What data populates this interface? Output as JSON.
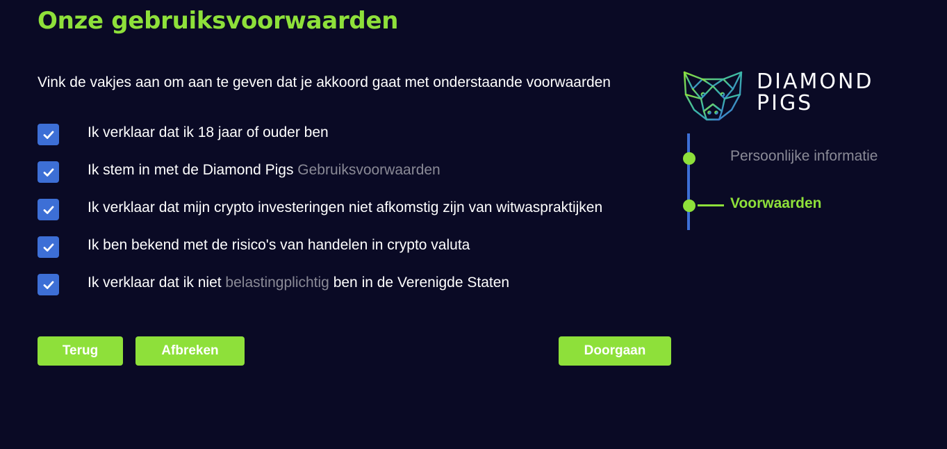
{
  "page": {
    "title": "Onze gebruiksvoorwaarden",
    "instruction": "Vink de vakjes aan om aan te geven dat je akkoord gaat met onderstaande voorwaarden"
  },
  "checklist": [
    {
      "checked": true,
      "text_before": "Ik verklaar dat ik 18 jaar of ouder ben",
      "link": "",
      "text_after": ""
    },
    {
      "checked": true,
      "text_before": "Ik stem in met de Diamond Pigs ",
      "link": "Gebruiksvoorwaarden",
      "text_after": ""
    },
    {
      "checked": true,
      "text_before": "Ik verklaar dat mijn crypto investeringen niet afkomstig zijn van witwaspraktijken",
      "link": "",
      "text_after": ""
    },
    {
      "checked": true,
      "text_before": "Ik ben bekend met de risico's van handelen in crypto valuta",
      "link": "",
      "text_after": ""
    },
    {
      "checked": true,
      "text_before": "Ik verklaar dat ik niet ",
      "link": "belastingplichtig",
      "text_after": " ben in de Verenigde Staten"
    }
  ],
  "buttons": {
    "back": "Terug",
    "cancel": "Afbreken",
    "continue": "Doorgaan"
  },
  "logo": {
    "line1": "DIAMOND",
    "line2": "PIGS",
    "icon": "diamond-pig-icon"
  },
  "steps": [
    {
      "label": "Persoonlijke informatie",
      "active": false
    },
    {
      "label": "Voorwaarden",
      "active": true
    }
  ],
  "colors": {
    "background": "#0a0a25",
    "accent": "#8ee03a",
    "checkbox": "#3d6fd6",
    "muted": "#8a8a96",
    "stepper_line": "#3d6fd6"
  },
  "icons": {
    "checkbox": "checkmark-icon"
  }
}
